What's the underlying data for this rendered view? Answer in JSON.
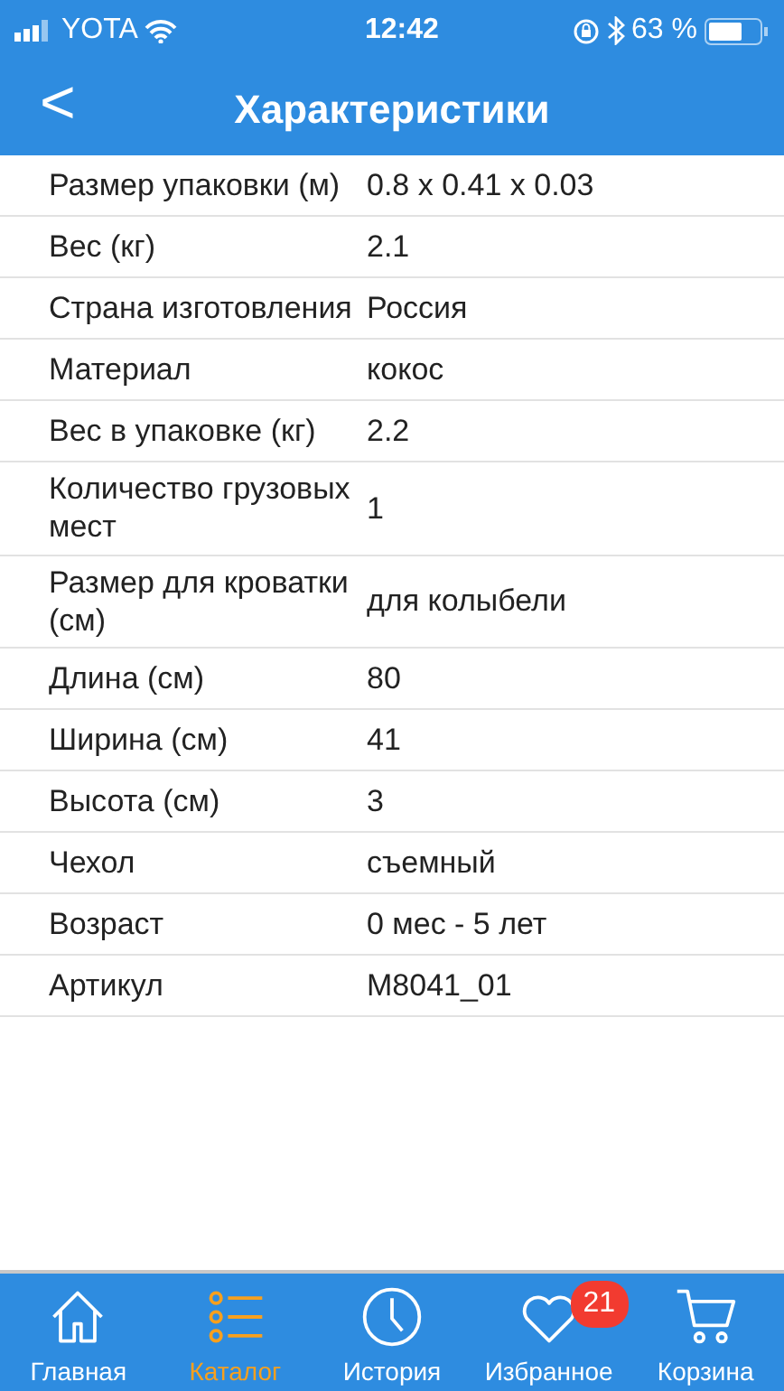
{
  "status_bar": {
    "carrier": "YOTA",
    "time": "12:42",
    "battery": "63 %"
  },
  "header": {
    "back": "<",
    "title": "Характеристики"
  },
  "specs": [
    {
      "label": "Размер упаковки (м)",
      "value": "0.8 x 0.41 x 0.03"
    },
    {
      "label": "Вес (кг)",
      "value": "2.1"
    },
    {
      "label": "Страна изготовления",
      "value": "Россия"
    },
    {
      "label": "Материал",
      "value": "кокос"
    },
    {
      "label": "Вес в упаковке (кг)",
      "value": "2.2"
    },
    {
      "label": "Количество грузовых мест",
      "value": "1"
    },
    {
      "label": "Размер для кроватки (см)",
      "value": "для колыбели"
    },
    {
      "label": "Длина (см)",
      "value": "80"
    },
    {
      "label": "Ширина (см)",
      "value": "41"
    },
    {
      "label": "Высота (см)",
      "value": "3"
    },
    {
      "label": "Чехол",
      "value": "съемный"
    },
    {
      "label": "Возраст",
      "value": "0 мес - 5 лет"
    },
    {
      "label": "Артикул",
      "value": "M8041_01"
    }
  ],
  "tabs": [
    {
      "kind": "home",
      "label": "Главная",
      "selected": false
    },
    {
      "kind": "catalog",
      "label": "Каталог",
      "selected": true
    },
    {
      "kind": "history",
      "label": "История",
      "selected": false
    },
    {
      "kind": "favorites",
      "label": "Избранное",
      "selected": false,
      "badge": "21"
    },
    {
      "kind": "cart",
      "label": "Корзина",
      "selected": false
    }
  ]
}
